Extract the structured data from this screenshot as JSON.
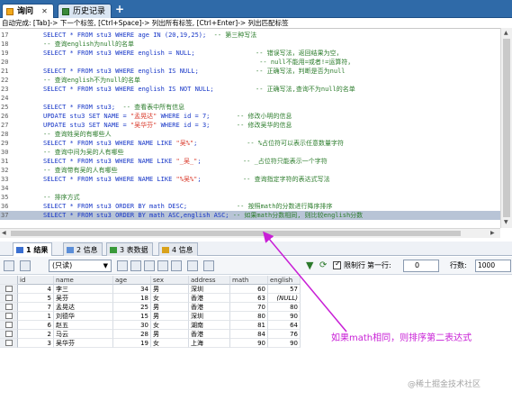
{
  "tabs": [
    {
      "label": "询问",
      "active": true
    },
    {
      "label": "历史记录",
      "active": false
    }
  ],
  "new_tab_label": "+",
  "close_label": "✕",
  "hint": "自动完成: [Tab]-> 下一个标签, [Ctrl+Space]-> 列出所有标签, [Ctrl+Enter]-> 列出匹配标签",
  "editor": {
    "lines": [
      {
        "num": "17",
        "segments": [
          [
            "SELECT * FROM stu3 WHERE age IN (20,19,25);  ",
            "kw"
          ],
          [
            "-- 第三种写法",
            "cmt"
          ]
        ]
      },
      {
        "num": "18",
        "segments": [
          [
            "-- 查询english为null的名单",
            "cmt"
          ]
        ]
      },
      {
        "num": "19",
        "segments": [
          [
            "SELECT * FROM stu3 WHERE english = NULL;",
            "kw"
          ],
          [
            "                ",
            "plain"
          ],
          [
            "-- 错误写法，返回结果为空，",
            "cmt"
          ]
        ]
      },
      {
        "num": "20",
        "segments": [
          [
            "                                                         ",
            "plain"
          ],
          [
            "-- null不能用=或者!=运算符，",
            "cmt"
          ]
        ]
      },
      {
        "num": "21",
        "segments": [
          [
            "SELECT * FROM stu3 WHERE english IS NULL;",
            "kw"
          ],
          [
            "               ",
            "plain"
          ],
          [
            "-- 正确写法，判断是否为null",
            "cmt"
          ]
        ]
      },
      {
        "num": "22",
        "segments": [
          [
            "-- 查询english不为null的名单",
            "cmt"
          ]
        ]
      },
      {
        "num": "23",
        "segments": [
          [
            "SELECT * FROM stu3 WHERE english IS NOT NULL;",
            "kw"
          ],
          [
            "           ",
            "plain"
          ],
          [
            "-- 正确写法,查询不为null的名单",
            "cmt"
          ]
        ]
      },
      {
        "num": "24",
        "segments": []
      },
      {
        "num": "25",
        "segments": [
          [
            "SELECT * FROM stu3;",
            "kw"
          ],
          [
            "  ",
            "plain"
          ],
          [
            "-- 查看表中所有信息",
            "cmt"
          ]
        ]
      },
      {
        "num": "26",
        "segments": [
          [
            "UPDATE stu3 SET NAME = ",
            "kw"
          ],
          [
            "\"孟晃达\"",
            "str"
          ],
          [
            " WHERE id = 7;",
            "kw"
          ],
          [
            "       ",
            "plain"
          ],
          [
            "-- 修改小明的信息",
            "cmt"
          ]
        ]
      },
      {
        "num": "27",
        "segments": [
          [
            "UPDATE stu3 SET NAME = ",
            "kw"
          ],
          [
            "\"吴华芬\"",
            "str"
          ],
          [
            " WHERE id = 3;",
            "kw"
          ],
          [
            "       ",
            "plain"
          ],
          [
            "-- 修改吴华的信息",
            "cmt"
          ]
        ]
      },
      {
        "num": "28",
        "segments": [
          [
            "-- 查询姓吴的有哪些人",
            "cmt"
          ]
        ]
      },
      {
        "num": "29",
        "segments": [
          [
            "SELECT * FROM stu3 WHERE NAME LIKE ",
            "kw"
          ],
          [
            "\"吴%\"",
            "str"
          ],
          [
            ";",
            "kw"
          ],
          [
            "             ",
            "plain"
          ],
          [
            "-- %占位符可以表示任意数量字符",
            "cmt"
          ]
        ]
      },
      {
        "num": "30",
        "segments": [
          [
            "-- 查询中间为吴的人有哪些",
            "cmt"
          ]
        ]
      },
      {
        "num": "31",
        "segments": [
          [
            "SELECT * FROM stu3 WHERE NAME LIKE ",
            "kw"
          ],
          [
            "\"_吴_\"",
            "str"
          ],
          [
            ";",
            "kw"
          ],
          [
            "           ",
            "plain"
          ],
          [
            "-- _占位符只能表示一个字符",
            "cmt"
          ]
        ]
      },
      {
        "num": "32",
        "segments": [
          [
            "-- 查询带有吴的人有哪些",
            "cmt"
          ]
        ]
      },
      {
        "num": "33",
        "segments": [
          [
            "SELECT * FROM stu3 WHERE NAME LIKE ",
            "kw"
          ],
          [
            "\"%吴%\"",
            "str"
          ],
          [
            ";",
            "kw"
          ],
          [
            "           ",
            "plain"
          ],
          [
            "-- 查询指定字符的表达式写法",
            "cmt"
          ]
        ]
      },
      {
        "num": "34",
        "segments": []
      },
      {
        "num": "35",
        "segments": [
          [
            "-- 排序方式",
            "cmt"
          ]
        ]
      },
      {
        "num": "36",
        "segments": [
          [
            "SELECT * FROM stu3 ORDER BY math DESC;",
            "kw"
          ],
          [
            "             ",
            "plain"
          ],
          [
            "-- 按照math的分数进行降序排序",
            "cmt"
          ]
        ]
      },
      {
        "num": "37",
        "highlighted": true,
        "segments": [
          [
            "SELECT * FROM stu3 ORDER BY math ASC,english ASC;",
            "kw"
          ],
          [
            " ",
            "plain"
          ],
          [
            "-- 如果math分数相同, 则比较english分数",
            "cmt"
          ]
        ]
      }
    ]
  },
  "result_tabs": [
    {
      "label": "1 结果",
      "active": true,
      "icon_color": "#3a6fd1"
    },
    {
      "label": "2 信息",
      "active": false,
      "icon_color": "#5b8ed8"
    },
    {
      "label": "3 表数据",
      "active": false,
      "icon_color": "#3a9a3a"
    },
    {
      "label": "4 信息",
      "active": false,
      "icon_color": "#d9a21b"
    }
  ],
  "toolbar": {
    "mode": "(只读)",
    "limit_label": "限制行",
    "first_row_label": "第一行:",
    "first_row_value": "0",
    "rows_label": "行数:",
    "rows_value": "1000"
  },
  "grid": {
    "columns": [
      "id",
      "name",
      "age",
      "sex",
      "address",
      "math",
      "english"
    ],
    "rows": [
      [
        "4",
        "李三",
        "34",
        "男",
        "深圳",
        "60",
        "57"
      ],
      [
        "5",
        "吴芬",
        "18",
        "女",
        "香港",
        "63",
        "(NULL)"
      ],
      [
        "7",
        "孟晃达",
        "25",
        "男",
        "香港",
        "70",
        "80"
      ],
      [
        "1",
        "刘德华",
        "15",
        "男",
        "深圳",
        "80",
        "90"
      ],
      [
        "6",
        "赵五",
        "30",
        "女",
        "湖南",
        "81",
        "64"
      ],
      [
        "2",
        "马云",
        "28",
        "男",
        "香港",
        "84",
        "76"
      ],
      [
        "3",
        "吴华芬",
        "19",
        "女",
        "上海",
        "90",
        "90"
      ]
    ]
  },
  "annotation": "如果math相同，则排序第二表达式",
  "annotation_color": "#c81fd6",
  "watermark": "@稀土掘金技术社区"
}
